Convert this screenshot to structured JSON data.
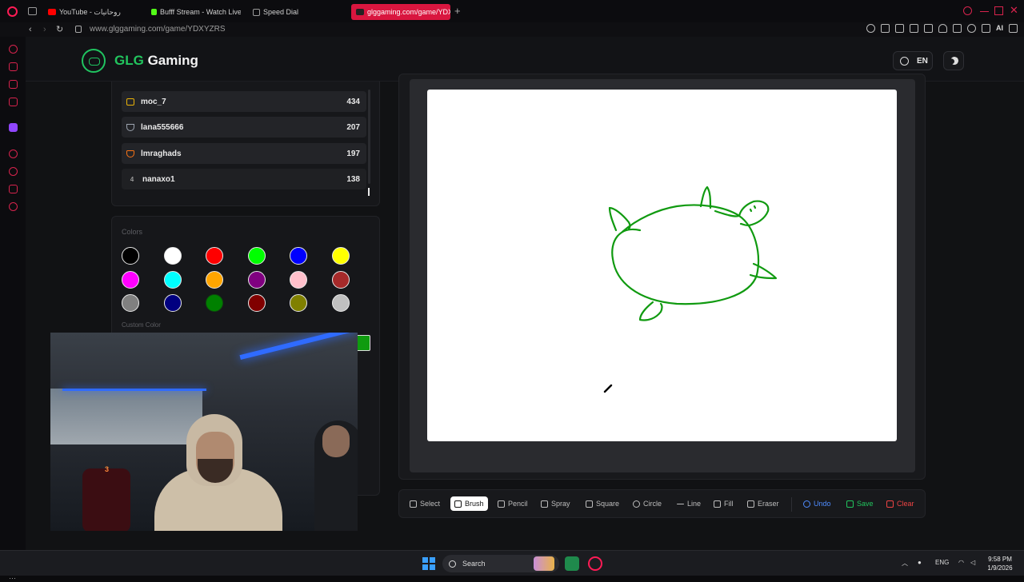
{
  "browser": {
    "tabs": [
      {
        "label": "YouTube - روحانيات",
        "color": "#ff0000"
      },
      {
        "label": "Bufff Stream - Watch Live",
        "color": "#53fc18"
      },
      {
        "label": "Speed Dial",
        "color": "#9a9a9a"
      },
      {
        "label": "glggaming.com/game/YDX",
        "color": "#222222"
      }
    ],
    "new_tab": "+",
    "url": "www.glggaming.com/game/YDXYZRS",
    "ai_label": "AI"
  },
  "sidebar": {
    "gx_label": "GX",
    "more": "···"
  },
  "header": {
    "brand_glg": "GLG",
    "brand_rest": "Gaming",
    "language": "EN"
  },
  "leaderboard": {
    "rows": [
      {
        "rank": "",
        "icon": "crown-icon",
        "icon_color": "#eab308",
        "name": "moc_7",
        "score": "434"
      },
      {
        "rank": "",
        "icon": "trophy-icon",
        "icon_color": "#9ca3af",
        "name": "lana555666",
        "score": "207"
      },
      {
        "rank": "",
        "icon": "medal-icon",
        "icon_color": "#f97316",
        "name": "lmraghads",
        "score": "197"
      },
      {
        "rank": "4",
        "icon": "",
        "icon_color": "",
        "name": "nanaxo1",
        "score": "138"
      }
    ]
  },
  "colors": {
    "title": "Colors",
    "custom_label": "Custom Color",
    "custom_value": "#0f9b0f",
    "swatches": [
      "#000000",
      "#ffffff",
      "#ff0000",
      "#00ff00",
      "#0000ff",
      "#ffff00",
      "#ff00ff",
      "#00ffff",
      "#ffa500",
      "#800080",
      "#ffc0cb",
      "#a52a2a",
      "#808080",
      "#000080",
      "#008000",
      "#800000",
      "#808000",
      "#c0c0c0"
    ],
    "selected": "#008000"
  },
  "webcam": {
    "overlay_number": "3"
  },
  "drawing": {
    "stroke_color": "#109a10"
  },
  "toolbar": {
    "select": "Select",
    "brush": "Brush",
    "pencil": "Pencil",
    "spray": "Spray",
    "square": "Square",
    "circle": "Circle",
    "line": "Line",
    "fill": "Fill",
    "eraser": "Eraser",
    "undo": "Undo",
    "save": "Save",
    "clear": "Clear",
    "active_tool": "Brush"
  },
  "taskbar": {
    "search_label": "Search",
    "language": "ENG",
    "time": "9:58 PM",
    "date": "1/9/2026"
  }
}
